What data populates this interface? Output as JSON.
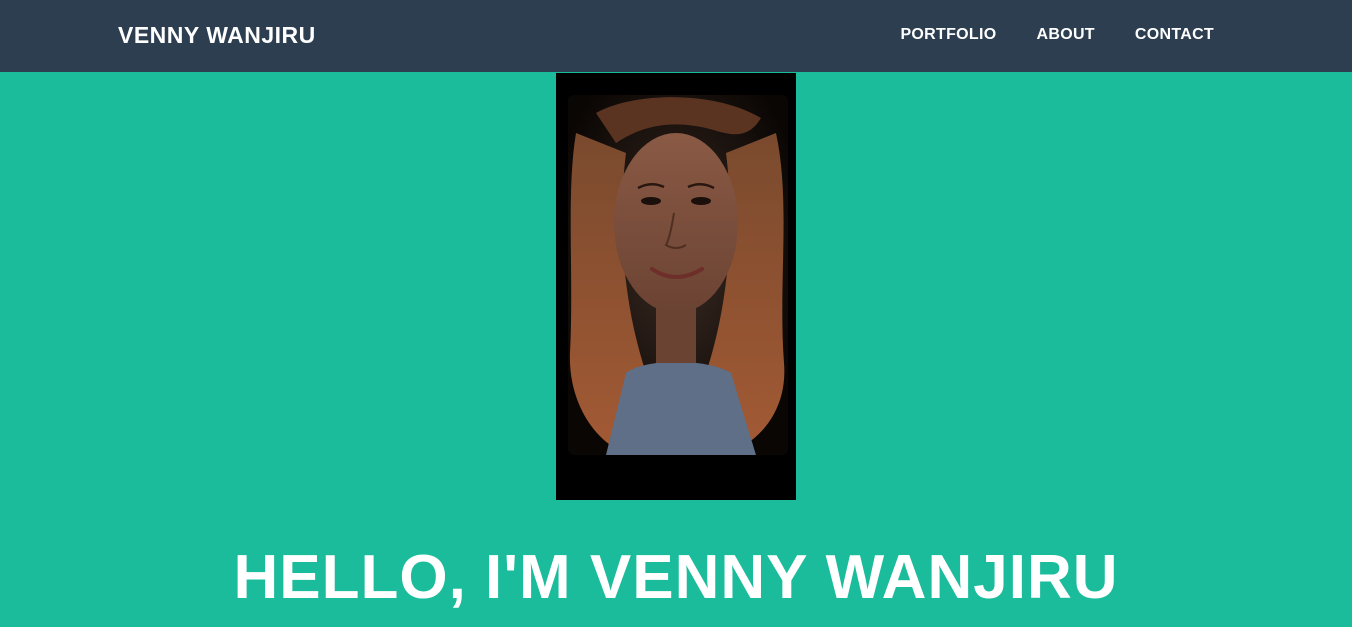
{
  "navbar": {
    "brand": "VENNY WANJIRU",
    "links": [
      "PORTFOLIO",
      "ABOUT",
      "CONTACT"
    ]
  },
  "masthead": {
    "avatar_icon": "profile-photo",
    "headline": "HELLO, I'M VENNY WANJIRU"
  },
  "colors": {
    "navbar_bg": "#2c3e50",
    "masthead_bg": "#1abc9c",
    "text": "#ffffff"
  }
}
